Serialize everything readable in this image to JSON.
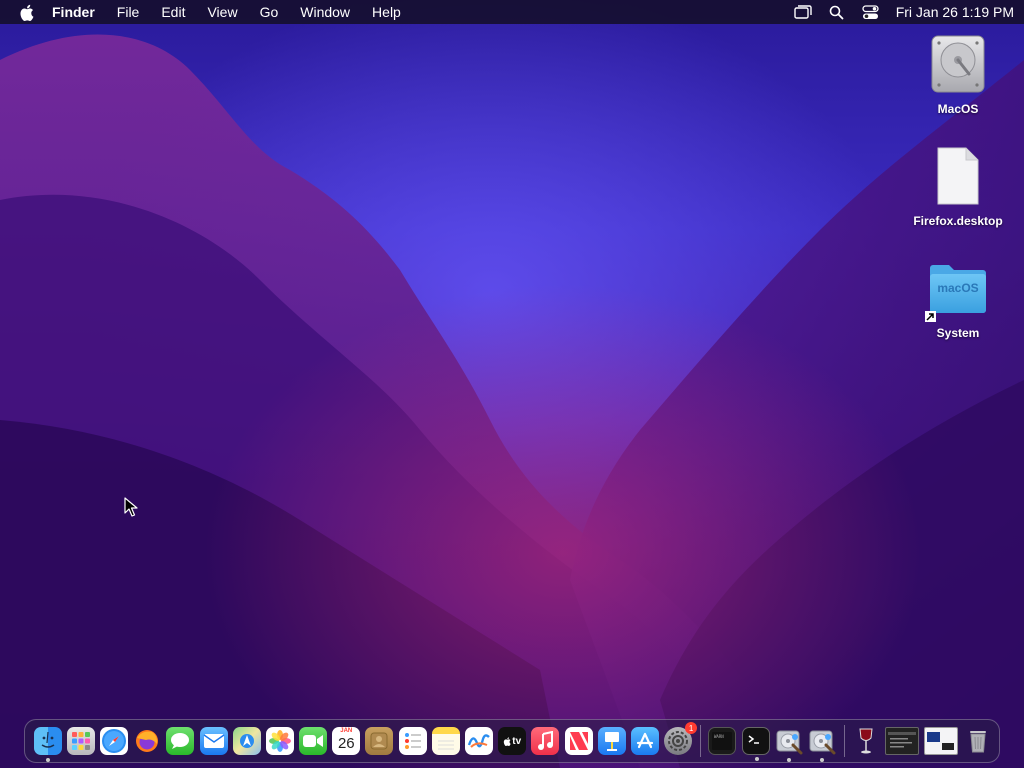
{
  "menubar": {
    "apple_icon": "apple-logo-icon",
    "app_name": "Finder",
    "menus": [
      "File",
      "Edit",
      "View",
      "Go",
      "Window",
      "Help"
    ],
    "status_icons": [
      "screen-mirroring-icon",
      "spotlight-search-icon",
      "control-center-icon"
    ],
    "clock": "Fri Jan 26  1:19 PM"
  },
  "desktop": {
    "icons": [
      {
        "label": "MacOS",
        "icon": "hard-drive-icon"
      },
      {
        "label": "Firefox.desktop",
        "icon": "document-file-icon"
      },
      {
        "label": "System",
        "icon": "folder-alias-icon",
        "folder_text": "macOS"
      }
    ]
  },
  "dock": {
    "apps": [
      {
        "name": "Finder",
        "icon": "finder-icon",
        "running": true
      },
      {
        "name": "Launchpad",
        "icon": "launchpad-icon",
        "running": false
      },
      {
        "name": "Safari",
        "icon": "safari-icon",
        "running": false
      },
      {
        "name": "Firefox",
        "icon": "firefox-icon",
        "running": false
      },
      {
        "name": "Messages",
        "icon": "messages-icon",
        "running": false
      },
      {
        "name": "Mail",
        "icon": "mail-icon",
        "running": false
      },
      {
        "name": "Maps",
        "icon": "maps-icon",
        "running": false
      },
      {
        "name": "Photos",
        "icon": "photos-icon",
        "running": false
      },
      {
        "name": "FaceTime",
        "icon": "facetime-icon",
        "running": false
      },
      {
        "name": "Calendar",
        "icon": "calendar-icon",
        "running": false,
        "month": "JAN",
        "day": "26"
      },
      {
        "name": "Contacts",
        "icon": "contacts-icon",
        "running": false
      },
      {
        "name": "Reminders",
        "icon": "reminders-icon",
        "running": false
      },
      {
        "name": "Notes",
        "icon": "notes-icon",
        "running": false
      },
      {
        "name": "Freeform",
        "icon": "freeform-icon",
        "running": false
      },
      {
        "name": "TV",
        "icon": "apple-tv-icon",
        "running": false,
        "text": "tv"
      },
      {
        "name": "Music",
        "icon": "music-icon",
        "running": false
      },
      {
        "name": "News",
        "icon": "news-icon",
        "running": false
      },
      {
        "name": "Keynote",
        "icon": "keynote-icon",
        "running": false
      },
      {
        "name": "App Store",
        "icon": "app-store-icon",
        "running": false
      },
      {
        "name": "System Settings",
        "icon": "system-settings-icon",
        "running": false,
        "badge": "1"
      }
    ],
    "utilities": [
      {
        "name": "Console",
        "icon": "console-icon",
        "running": false
      },
      {
        "name": "Terminal",
        "icon": "terminal-icon",
        "running": true
      },
      {
        "name": "Disk Utility 1",
        "icon": "disk-utility-icon",
        "running": true
      },
      {
        "name": "Disk Utility 2",
        "icon": "disk-utility-icon",
        "running": true
      }
    ],
    "extras": [
      {
        "name": "Wine",
        "icon": "wine-glass-icon",
        "running": false
      },
      {
        "name": "Window Minimized 1",
        "icon": "minimized-window-icon",
        "running": false
      },
      {
        "name": "Window Minimized 2",
        "icon": "minimized-window-icon",
        "running": false
      },
      {
        "name": "Trash",
        "icon": "trash-icon",
        "running": false
      }
    ]
  }
}
